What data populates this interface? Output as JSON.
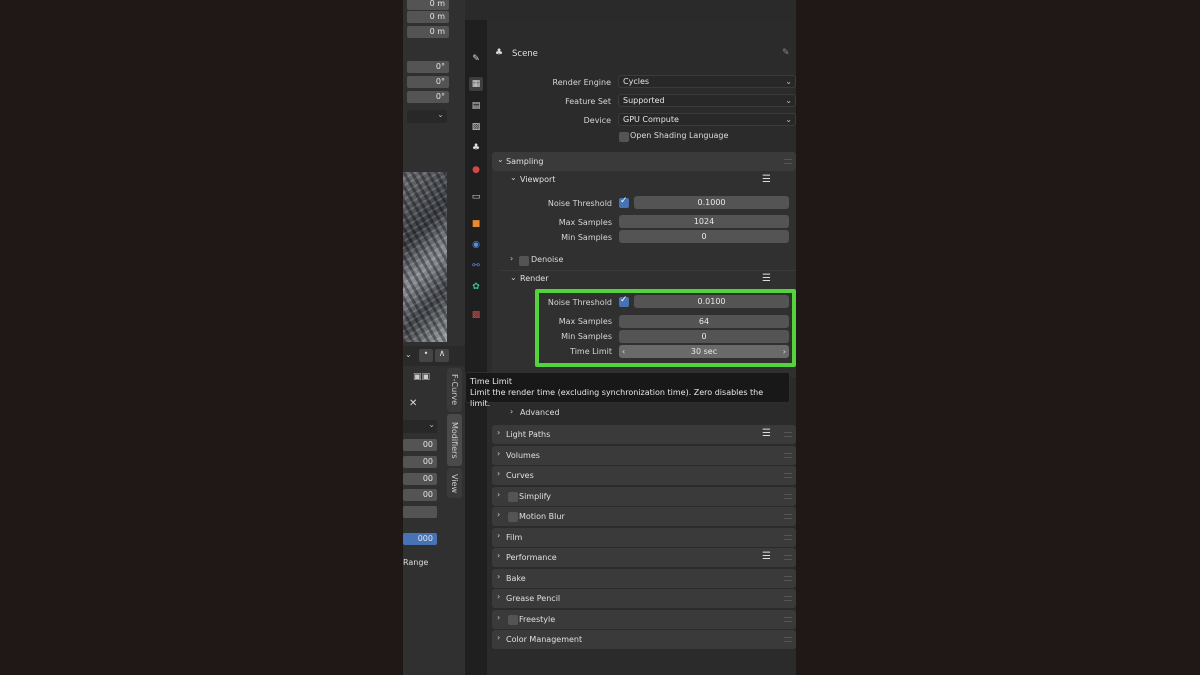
{
  "left_panel": {
    "fields_top": [
      "0 m",
      "0 m",
      "0 m"
    ],
    "rotation_fields": [
      "0°",
      "0°",
      "0°"
    ],
    "values_bottom": [
      "00",
      "00",
      "00",
      "00"
    ],
    "highlight_value": "000",
    "range_label": "Range",
    "tabs": [
      "F-Curve",
      "Modifiers",
      "View"
    ]
  },
  "header": {
    "editor_icon": "properties-icon"
  },
  "breadcrumb": {
    "scene": "Scene"
  },
  "render_engine": {
    "label": "Render Engine",
    "value": "Cycles"
  },
  "feature_set": {
    "label": "Feature Set",
    "value": "Supported"
  },
  "device": {
    "label": "Device",
    "value": "GPU Compute"
  },
  "osl": {
    "label": "Open Shading Language",
    "checked": false
  },
  "sampling": {
    "title": "Sampling",
    "viewport": {
      "title": "Viewport",
      "noise_threshold_label": "Noise Threshold",
      "noise_threshold": "0.1000",
      "max_samples_label": "Max Samples",
      "max_samples": "1024",
      "min_samples_label": "Min Samples",
      "min_samples": "0",
      "denoise_label": "Denoise"
    },
    "render": {
      "title": "Render",
      "noise_threshold_label": "Noise Threshold",
      "noise_threshold": "0.0100",
      "max_samples_label": "Max Samples",
      "max_samples": "64",
      "min_samples_label": "Min Samples",
      "min_samples": "0",
      "time_limit_label": "Time Limit",
      "time_limit": "30 sec"
    },
    "advanced_label": "Advanced"
  },
  "tooltip": {
    "title": "Time Limit",
    "body": "Limit the render time (excluding synchronization time). Zero disables the limit."
  },
  "panels": [
    "Light Paths",
    "Volumes",
    "Curves",
    "Simplify",
    "Motion Blur",
    "Film",
    "Performance",
    "Bake",
    "Grease Pencil",
    "Freestyle",
    "Color Management"
  ],
  "colors": {
    "highlight": "#55d33c",
    "checkbox_on": "#4772b3"
  }
}
